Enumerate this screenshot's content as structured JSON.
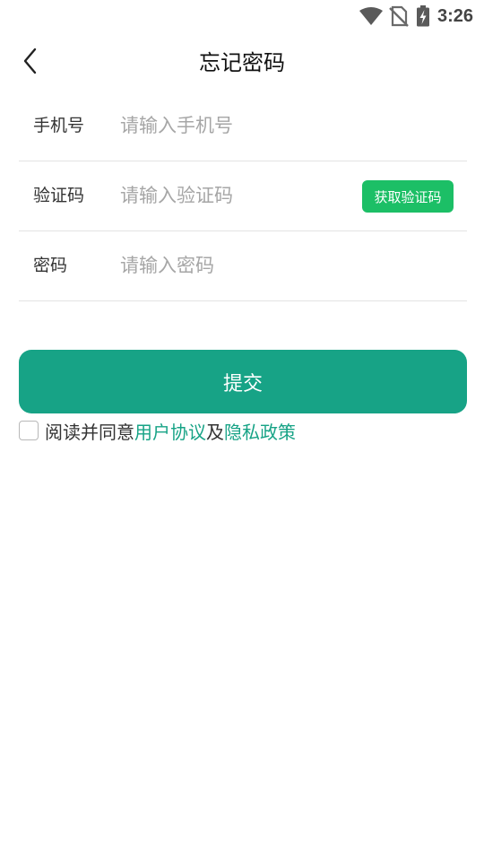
{
  "status_bar": {
    "time": "3:26",
    "icons": [
      "wifi-icon",
      "no-sim-icon",
      "battery-charging-icon"
    ]
  },
  "header": {
    "back_icon": "chevron-left-icon",
    "title": "忘记密码"
  },
  "form": {
    "phone": {
      "label": "手机号",
      "placeholder": "请输入手机号",
      "value": ""
    },
    "code": {
      "label": "验证码",
      "placeholder": "请输入验证码",
      "value": "",
      "button_label": "获取验证码"
    },
    "password": {
      "label": "密码",
      "placeholder": "请输入密码",
      "value": ""
    }
  },
  "submit": {
    "label": "提交"
  },
  "agreement": {
    "checked": false,
    "prefix": "阅读并同意",
    "user_agreement": "用户协议",
    "and": "及",
    "privacy_policy": "隐私政策"
  },
  "colors": {
    "primary": "#17a386",
    "code_button": "#1cbf66",
    "placeholder": "#a6a6a6",
    "divider": "#e3e3e3"
  }
}
